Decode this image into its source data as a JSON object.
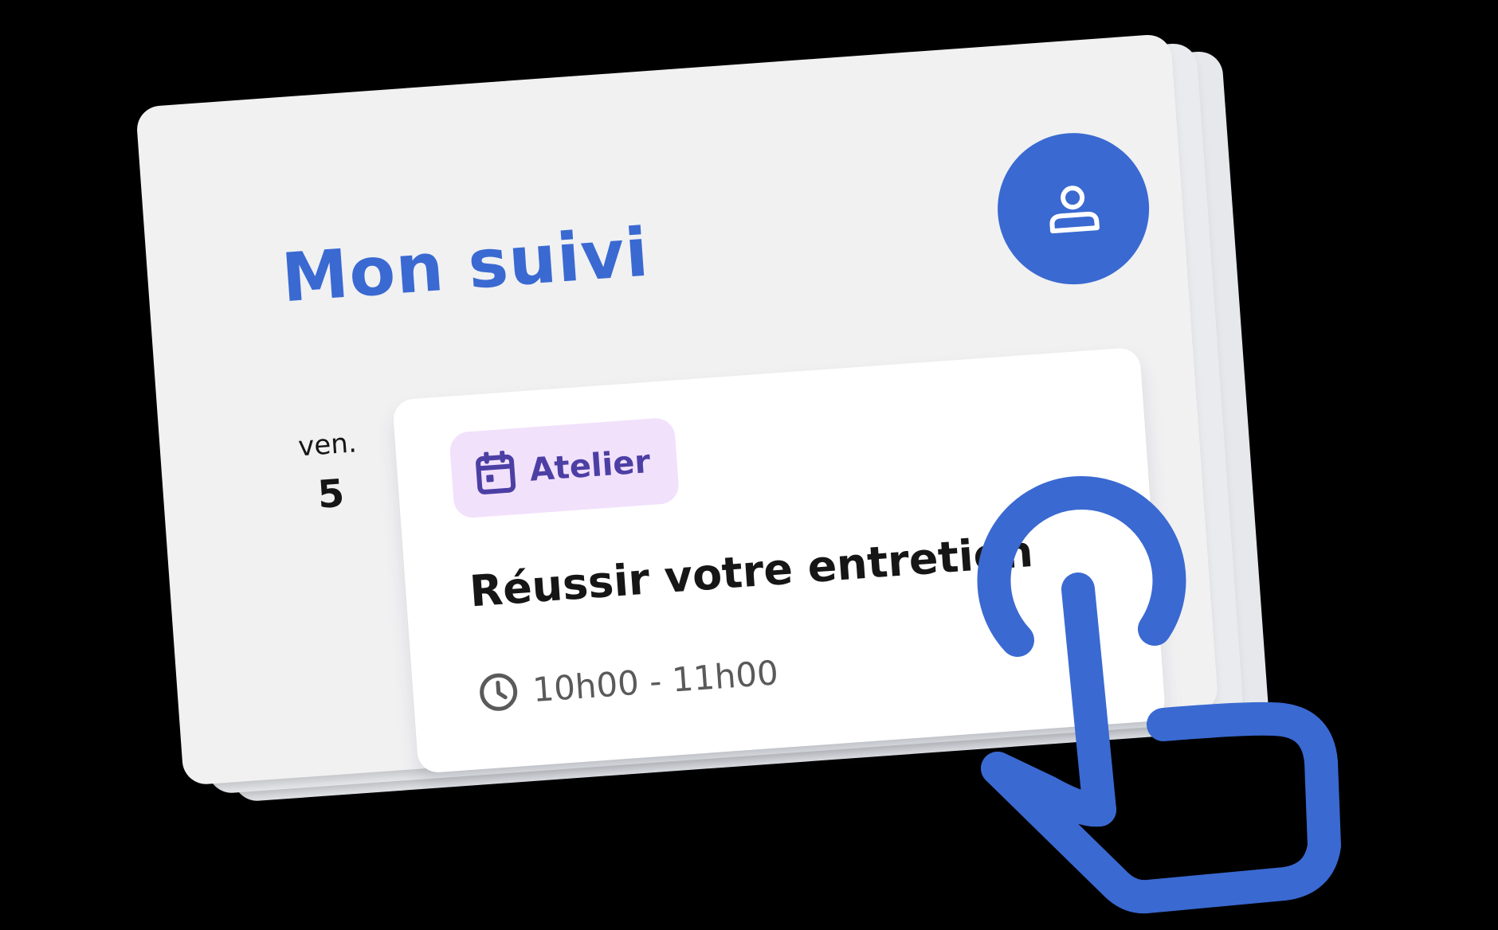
{
  "header": {
    "title": "Mon suivi",
    "profile_icon": "user-icon"
  },
  "agenda": {
    "date": {
      "weekday": "ven.",
      "day": "5"
    },
    "event": {
      "tag_icon": "calendar-icon",
      "tag_label": "Atelier",
      "title": "Réussir votre entretien",
      "time_icon": "clock-icon",
      "time": "10h00 - 11h00"
    }
  },
  "overlay": {
    "gesture_icon": "tap-hand-icon"
  },
  "colors": {
    "brand_blue": "#3a69d1",
    "tag_background": "#f2e1fb",
    "tag_text": "#4c3fa4",
    "card_background": "#f1f1f2",
    "text_primary": "#161616",
    "text_secondary": "#5a5a5a"
  }
}
